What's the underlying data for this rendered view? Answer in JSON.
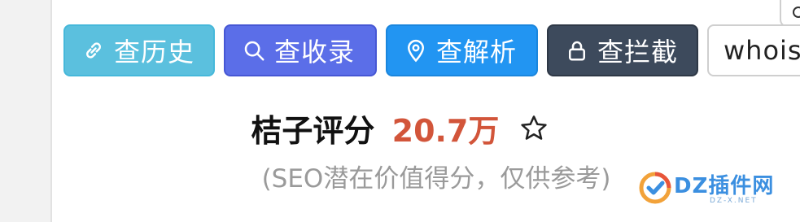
{
  "toolbar": {
    "buttons": [
      {
        "label": "查历史",
        "icon": "link-icon",
        "color": "#5bc0de"
      },
      {
        "label": "查收录",
        "icon": "search-icon",
        "color": "#5b6ee8"
      },
      {
        "label": "查解析",
        "icon": "location-pin-icon",
        "color": "#2295f2"
      },
      {
        "label": "查拦截",
        "icon": "lock-icon",
        "color": "#3d4a5c"
      },
      {
        "label": "whois",
        "icon": "",
        "color": "#ffffff"
      }
    ]
  },
  "score": {
    "label": "桔子评分",
    "value": "20.7万",
    "value_color": "#d2553a",
    "icon": "star-outline-icon",
    "note": "(SEO潜在价值得分，仅供参考)"
  },
  "watermark": {
    "text": "DZ插件网",
    "subtext": "DZ-X.NET"
  }
}
